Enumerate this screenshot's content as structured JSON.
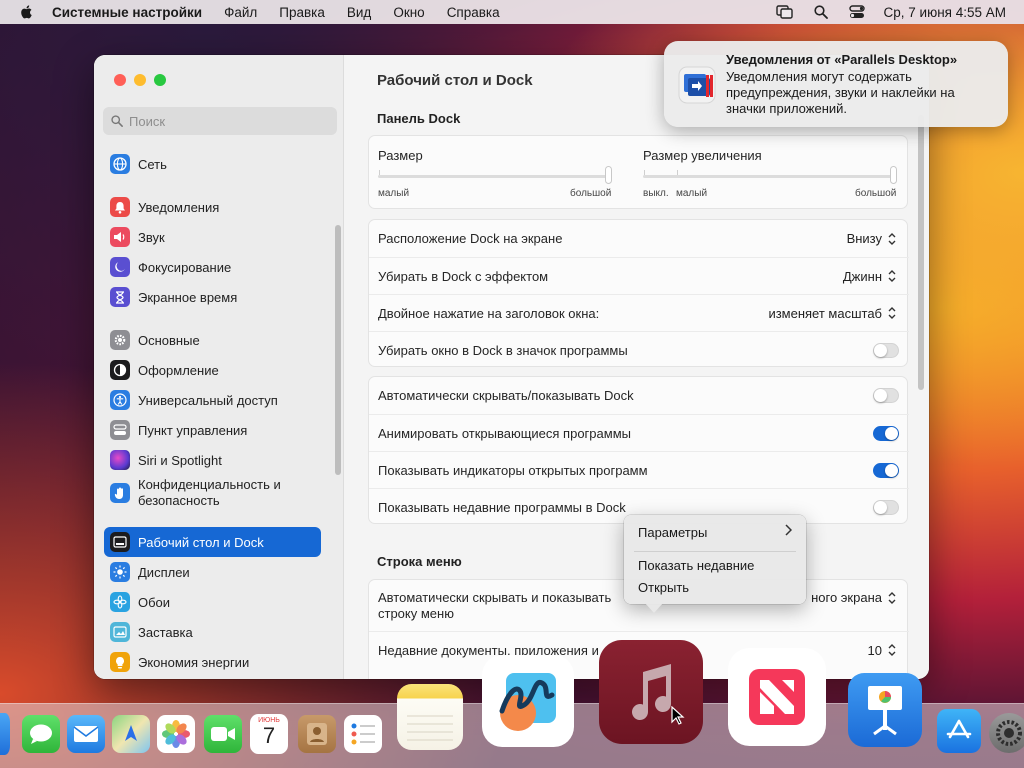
{
  "menubar": {
    "app_name": "Системные настройки",
    "items": [
      "Файл",
      "Правка",
      "Вид",
      "Окно",
      "Справка"
    ],
    "clock": "Ср, 7 июня  4:55 AM"
  },
  "sidebar": {
    "search_placeholder": "Поиск",
    "items": [
      {
        "label": "Сеть",
        "icon": "globe-icon",
        "color": "#2a7de1"
      },
      {
        "label": "Уведомления",
        "icon": "bell-icon",
        "color": "#ec4b48"
      },
      {
        "label": "Звук",
        "icon": "speaker-icon",
        "color": "#ec4b5f"
      },
      {
        "label": "Фокусирование",
        "icon": "moon-icon",
        "color": "#5a4fd1"
      },
      {
        "label": "Экранное время",
        "icon": "hourglass-icon",
        "color": "#5a4fd1"
      },
      {
        "label": "Основные",
        "icon": "gear-icon",
        "color": "#8e8e93"
      },
      {
        "label": "Оформление",
        "icon": "appearance-icon",
        "color": "#1c1c1e"
      },
      {
        "label": "Универсальный доступ",
        "icon": "accessibility-icon",
        "color": "#2a7de1"
      },
      {
        "label": "Пункт управления",
        "icon": "control-center-icon",
        "color": "#8e8e93"
      },
      {
        "label": "Siri и Spotlight",
        "icon": "siri-icon",
        "color": "#a43ad1"
      },
      {
        "label": "Конфиденциальность и безопасность",
        "icon": "hand-icon",
        "color": "#2a7de1"
      },
      {
        "label": "Рабочий стол и Dock",
        "icon": "dock-icon",
        "color": "#1c1c1e"
      },
      {
        "label": "Дисплеи",
        "icon": "sun-icon",
        "color": "#2a7de1"
      },
      {
        "label": "Обои",
        "icon": "flower-icon",
        "color": "#2aa3e1"
      },
      {
        "label": "Заставка",
        "icon": "screensaver-icon",
        "color": "#4fb6d9"
      },
      {
        "label": "Экономия энергии",
        "icon": "bulb-icon",
        "color": "#f0a30a"
      }
    ],
    "selected_index": 11
  },
  "main": {
    "title": "Рабочий стол и Dock",
    "dock_section": "Панель Dock",
    "size_label": "Размер",
    "size_min": "малый",
    "size_max": "большой",
    "size_value": 1.0,
    "mag_label": "Размер увеличения",
    "mag_off": "выкл.",
    "mag_min": "малый",
    "mag_max": "большой",
    "mag_value": 1.0,
    "rows1": [
      {
        "label": "Расположение Dock на экране",
        "value": "Внизу"
      },
      {
        "label": "Убирать в Dock с эффектом",
        "value": "Джинн"
      },
      {
        "label": "Двойное нажатие на заголовок окна:",
        "value": "изменяет масштаб"
      },
      {
        "label": "Убирать окно в Dock в значок программы",
        "toggle": false
      }
    ],
    "rows2": [
      {
        "label": "Автоматически скрывать/показывать Dock",
        "toggle": false
      },
      {
        "label": "Анимировать открывающиеся программы",
        "toggle": true
      },
      {
        "label": "Показывать индикаторы открытых программ",
        "toggle": true
      },
      {
        "label": "Показывать недавние программы в Dock",
        "toggle": false
      }
    ],
    "menubar_section": "Строка меню",
    "rows3": [
      {
        "label_line1": "Автоматически скрывать и показывать",
        "label_line1_tail": "ного экрана",
        "label_line2": "строку меню"
      },
      {
        "label": "Недавние документы, приложения и",
        "value": "10"
      }
    ]
  },
  "notification": {
    "title": "Уведомления от «Parallels Desktop»",
    "body": "Уведомления могут содержать предупреждения, звуки и наклейки на значки приложений."
  },
  "context_menu": {
    "items": [
      "Параметры",
      "Показать недавние",
      "Открыть"
    ]
  },
  "dock": {
    "calendar_month": "ИЮНЬ",
    "calendar_day": "7",
    "apps": [
      "safari-icon",
      "messages-icon",
      "mail-icon",
      "maps-icon",
      "photos-icon",
      "facetime-icon",
      "calendar-icon",
      "contacts-icon",
      "reminders-icon",
      "notes-icon",
      "freeform-icon",
      "music-icon",
      "news-icon",
      "keynote-icon",
      "app-store-icon",
      "system-settings-icon"
    ]
  }
}
